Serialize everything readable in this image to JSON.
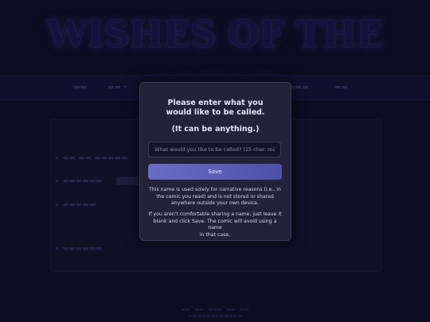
{
  "background": {
    "logo_text": "WISHES OF THE ALTAR"
  },
  "modal": {
    "title_line1": "Please enter what you",
    "title_line2": "would like to be called.",
    "subtitle": "(It can be anything.)",
    "input_placeholder": "What would you like to be called? (15 char. max)",
    "input_value": "",
    "save_label": "Save",
    "note1_line1": "This name is used solely for narrative reasons (i.e., in",
    "note1_line2": "the comic you read) and is not stored or shared",
    "note1_line3": "anywhere outside your own device.",
    "note2_line1": "If you aren't comfortable sharing a name, just leave it",
    "note2_line2": "blank and click Save. The comic will avoid using a name",
    "note2_line3": "in that case."
  },
  "colors": {
    "modal_bg": "#222238",
    "accent": "#5e5fb8",
    "page_bg": "#12102a"
  }
}
